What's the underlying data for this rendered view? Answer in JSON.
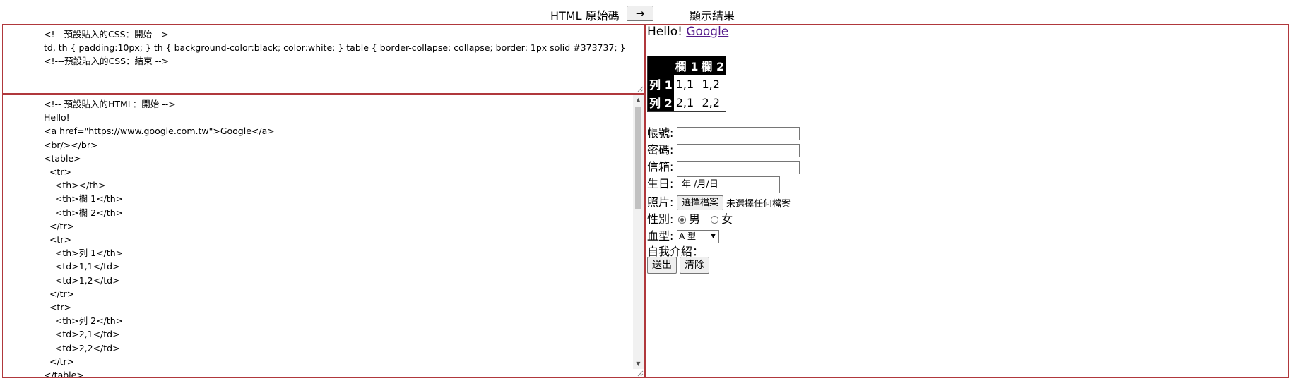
{
  "header": {
    "source_label": "HTML 原始碼",
    "arrow_button": "→",
    "result_label": "顯示結果"
  },
  "css_editor": {
    "code": "<!-- 預設貼入的CSS：開始 -->\ntd, th { padding:10px; } th { background-color:black; color:white; } table { border-collapse: collapse; border: 1px solid #373737; }\n<!---預設貼入的CSS：結束 -->"
  },
  "html_editor": {
    "code": "<!-- 預設貼入的HTML：開始 -->\nHello!\n<a href=\"https://www.google.com.tw\">Google</a>\n<br/></br>\n<table>\n  <tr>\n    <th></th>\n    <th>欄 1</th>\n    <th>欄 2</th>\n  </tr>\n  <tr>\n    <th>列 1</th>\n    <td>1,1</td>\n    <td>1,2</td>\n  </tr>\n  <tr>\n    <th>列 2</th>\n    <td>2,1</td>\n    <td>2,2</td>\n  </tr>\n</table>"
  },
  "result": {
    "hello": "Hello!",
    "link_text": "Google",
    "table": {
      "headers": [
        "",
        "欄 1",
        "欄 2"
      ],
      "rows": [
        {
          "label": "列 1",
          "cells": [
            "1,1",
            "1,2"
          ]
        },
        {
          "label": "列 2",
          "cells": [
            "2,1",
            "2,2"
          ]
        }
      ]
    },
    "form": {
      "account_label": "帳號:",
      "password_label": "密碼:",
      "email_label": "信箱:",
      "birthday_label": "生日:",
      "birthday_placeholder": "年 /月/日",
      "photo_label": "照片:",
      "file_button": "選擇檔案",
      "file_status": "未選擇任何檔案",
      "gender_label": "性別:",
      "gender_male": "男",
      "gender_female": "女",
      "blood_label": "血型:",
      "blood_value": "A 型",
      "intro_label": "自我介紹：",
      "submit_button": "送出",
      "clear_button": "清除"
    }
  }
}
